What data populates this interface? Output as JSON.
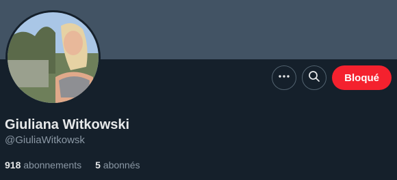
{
  "profile": {
    "name": "Giuliana Witkowski",
    "handle": "@GiuliaWitkowsk",
    "following_count": "918",
    "following_label": "abonnements",
    "followers_count": "5",
    "followers_label": "abonnés"
  },
  "actions": {
    "more_icon": "more-horizontal-icon",
    "search_icon": "search-icon",
    "blocked_label": "Bloqué"
  },
  "colors": {
    "background": "#15202b",
    "banner": "#425364",
    "blocked": "#f4212e",
    "text": "#e7e9ea",
    "muted": "#8b98a5"
  }
}
